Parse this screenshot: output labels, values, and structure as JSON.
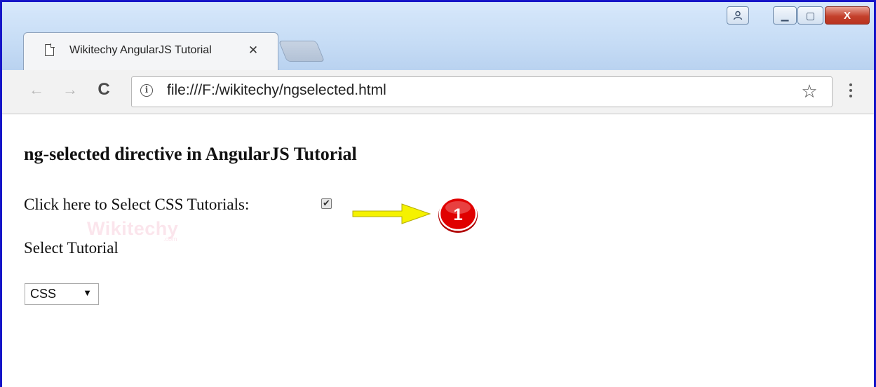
{
  "browser": {
    "tab_title": "Wikitechy AngularJS Tutorial",
    "tab_close_glyph": "✕",
    "url": "file:///F:/wikitechy/ngselected.html",
    "window_buttons": {
      "minimize": "▁",
      "maximize": "▢",
      "close": "X"
    }
  },
  "nav": {
    "back_glyph": "←",
    "forward_glyph": "→",
    "reload_glyph": "C"
  },
  "toolbar": {
    "info_glyph": "i",
    "star_glyph": "☆"
  },
  "page": {
    "heading": "ng-selected directive in AngularJS Tutorial",
    "checkbox_label": "Click here to Select CSS Tutorials:",
    "checkbox_checked": true,
    "checkbox_glyph": "✔",
    "select_label": "Select Tutorial",
    "select_value": "CSS",
    "select_arrow": "▼"
  },
  "annotation": {
    "badge_number": "1",
    "arrow_color": "#f5f200",
    "badge_color": "#e00000"
  },
  "watermark": {
    "text": "Wikitechy",
    "sub": ".com"
  }
}
